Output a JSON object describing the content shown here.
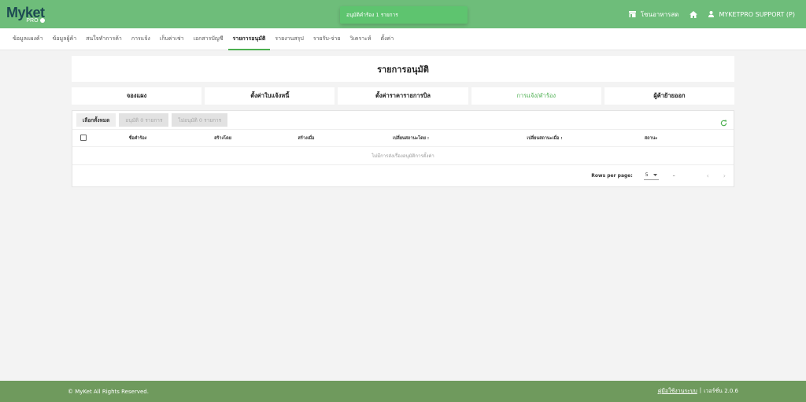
{
  "brand": {
    "name": "Myket",
    "sub": "PRO"
  },
  "topbar": {
    "shop_label": "โซนอาหารสด",
    "user_label": "MYKETPRO SUPPORT (P)"
  },
  "toast": {
    "text": "อนุมัติคำร้อง 1 รายการ"
  },
  "nav": {
    "items": [
      "ข้อมูลแผงค้า",
      "ข้อมูลผู้ค้า",
      "สนใจทำการค้า",
      "การแจ้ง",
      "เก็บค่าเช่า",
      "เอกสารบัญชี",
      "รายการอนุมัติ",
      "รายงานสรุป",
      "รายรับ-จ่าย",
      "วิเคราะห์",
      "ตั้งค่า"
    ],
    "active_index": 6
  },
  "page": {
    "title": "รายการอนุมัติ"
  },
  "tabs": {
    "items": [
      "จองแผง",
      "ตั้งค่าใบแจ้งหนี้",
      "ตั้งค่าราคารายการบิล",
      "การแจ้ง/คำร้อง",
      "ผู้ค้าย้ายออก"
    ],
    "active_index": 3
  },
  "toolbar": {
    "select_all": "เลือกทั้งหมด",
    "approve": "อนุมัติ 0 รายการ",
    "reject": "ไม่อนุมัติ 0 รายการ"
  },
  "table": {
    "columns": [
      "ชื่อคำร้อง",
      "สร้างโดย",
      "สร้างเมื่อ",
      "เปลี่ยนสถานะโดย :",
      "เปลี่ยนสถานะเมื่อ :",
      "สถานะ"
    ],
    "empty_text": "ไม่มีการส่งเรื่องอนุมัติการตั้งค่า"
  },
  "pagination": {
    "rows_per_page_label": "Rows per page:",
    "rows_per_page_value": "5",
    "range": "–"
  },
  "footer": {
    "copyright": "© MyKet All Rights Reserved.",
    "manual": "คู่มือใช้งานระบบ",
    "separator": "|",
    "version": "เวอร์ชั่น 2.0.6"
  },
  "colors": {
    "topbar": "#6ebd7a",
    "toast": "#5ec46f",
    "accent": "#4caf50",
    "footer": "#6f9a5d"
  }
}
